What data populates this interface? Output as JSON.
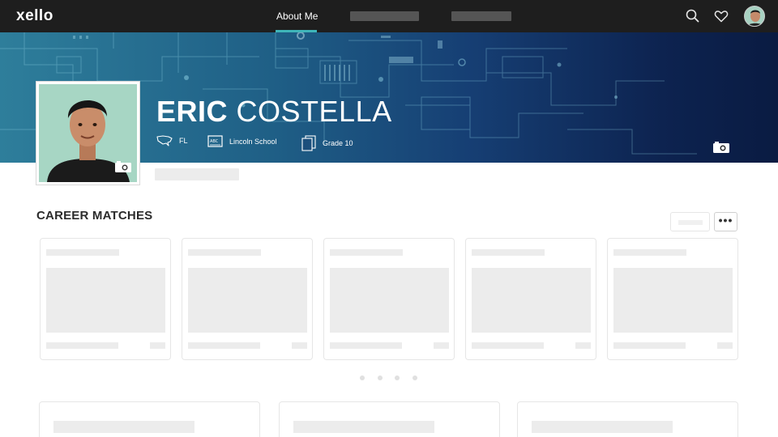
{
  "app": {
    "logo": "xello"
  },
  "nav": {
    "active_tab": "About Me"
  },
  "icons": {
    "search": "search-icon",
    "favorites": "heart-icon",
    "avatar": "user-avatar",
    "banner_camera": "camera-icon",
    "photo_camera": "camera-icon",
    "state": "us-map-icon",
    "school": "school-board-icon",
    "grade": "grade-pages-icon"
  },
  "profile": {
    "first_name": "ERIC",
    "last_name": "COSTELLA",
    "state": "FL",
    "school": "Lincoln School",
    "grade": "Grade 10"
  },
  "career_matches": {
    "title": "CAREER MATCHES",
    "more_label": "•••"
  },
  "colors": {
    "topbar": "#1e1e1e",
    "accent": "#3fb5b9",
    "skeleton": "#ececec"
  }
}
